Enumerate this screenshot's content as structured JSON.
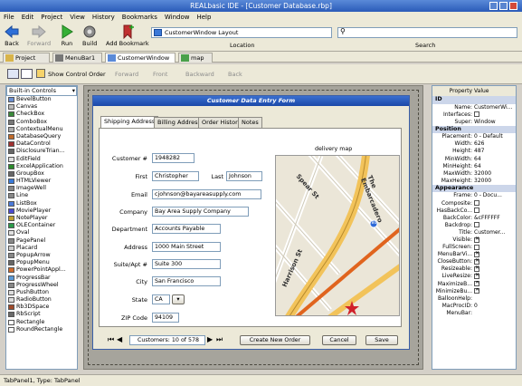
{
  "window": {
    "title": "REALbasic IDE - [Customer Database.rbp]"
  },
  "menu": [
    "File",
    "Edit",
    "Project",
    "View",
    "History",
    "Bookmarks",
    "Window",
    "Help"
  ],
  "toolbar": {
    "back": "Back",
    "forward": "Forward",
    "run": "Run",
    "build": "Build",
    "add_bookmark": "Add Bookmark",
    "location_value": "CustomerWindow Layout",
    "location_label": "Location",
    "search_label": "Search",
    "search_value": ""
  },
  "tabs": [
    {
      "label": "Project"
    },
    {
      "label": "MenuBar1"
    },
    {
      "label": "CustomerWindow"
    },
    {
      "label": "map"
    }
  ],
  "subtoolbar": {
    "show_control_order": "Show Control Order",
    "forward": "Forward",
    "front": "Front",
    "backward": "Backward",
    "back": "Back"
  },
  "controls_dropdown": "Built-in Controls",
  "controls": [
    "BevelButton",
    "Canvas",
    "CheckBox",
    "ComboBox",
    "ContextualMenu",
    "DatabaseQuery",
    "DataControl",
    "DisclosureTrian...",
    "EditField",
    "ExcelApplication",
    "GroupBox",
    "HTMLViewer",
    "ImageWell",
    "Line",
    "ListBox",
    "MoviePlayer",
    "NotePlayer",
    "OLEContainer",
    "Oval",
    "PagePanel",
    "Placard",
    "PopupArrow",
    "PopupMenu",
    "PowerPointAppl...",
    "ProgressBar",
    "ProgressWheel",
    "PushButton",
    "RadioButton",
    "Rb3DSpace",
    "RbScript",
    "Rectangle",
    "RoundRectangle"
  ],
  "form": {
    "title": "Customer Data Entry Form",
    "tabs": [
      "Shipping Address",
      "Billing Address",
      "Order History",
      "Notes"
    ],
    "labels": {
      "customer": "Customer #",
      "first": "First",
      "last": "Last",
      "email": "Email",
      "company": "Company",
      "department": "Department",
      "address": "Address",
      "suite": "Suite/Apt #",
      "city": "City",
      "state": "State",
      "zip": "ZIP Code",
      "map": "delivery map"
    },
    "values": {
      "customer": "1948282",
      "first": "Christopher",
      "last": "Johnson",
      "email": "cjohnson@bayareasupply.com",
      "company": "Bay Area Supply Company",
      "department": "Accounts Payable",
      "address": "1000 Main Street",
      "suite": "Suite 300",
      "city": "San Francisco",
      "state": "CA",
      "zip": "94109"
    },
    "map_streets": [
      "Spear St",
      "The Embarcadero",
      "Harrison St",
      "80"
    ],
    "nav_label": "Customers: 10 of 578",
    "create_order": "Create New Order",
    "cancel": "Cancel",
    "save": "Save"
  },
  "properties": {
    "header_property": "Property",
    "header_value": "Value",
    "sections": [
      {
        "name": "ID",
        "rows": [
          [
            "Name:",
            "CustomerWi..."
          ],
          [
            "Interfaces:",
            ""
          ],
          [
            "Super:",
            "Window"
          ]
        ]
      },
      {
        "name": "Position",
        "rows": [
          [
            "Placement:",
            "0 - Default"
          ],
          [
            "Width:",
            "626"
          ],
          [
            "Height:",
            "487"
          ],
          [
            "MinWidth:",
            "64"
          ],
          [
            "MinHeight:",
            "64"
          ],
          [
            "MaxWidth:",
            "32000"
          ],
          [
            "MaxHeight:",
            "32000"
          ]
        ]
      },
      {
        "name": "Appearance",
        "rows": [
          [
            "Frame:",
            "0 - Docu..."
          ],
          [
            "Composite:",
            ""
          ],
          [
            "HasBackCo...",
            ""
          ],
          [
            "BackColor:",
            "&cFFFFFF"
          ],
          [
            "Backdrop:",
            ""
          ],
          [
            "Title:",
            "Customer..."
          ],
          [
            "Visible:",
            "x"
          ],
          [
            "FullScreen:",
            ""
          ],
          [
            "MenuBarVi...",
            "x"
          ],
          [
            "CloseButton:",
            "x"
          ],
          [
            "Resizeable:",
            "x"
          ],
          [
            "LiveResize:",
            "x"
          ],
          [
            "MaximizeB...",
            "x"
          ],
          [
            "MinimizeBu...",
            "x"
          ],
          [
            "BalloonHelp:",
            ""
          ],
          [
            "MacProcID:",
            "0"
          ],
          [
            "MenuBar:",
            ""
          ]
        ]
      }
    ]
  },
  "status": "TabPanel1, Type: TabPanel"
}
